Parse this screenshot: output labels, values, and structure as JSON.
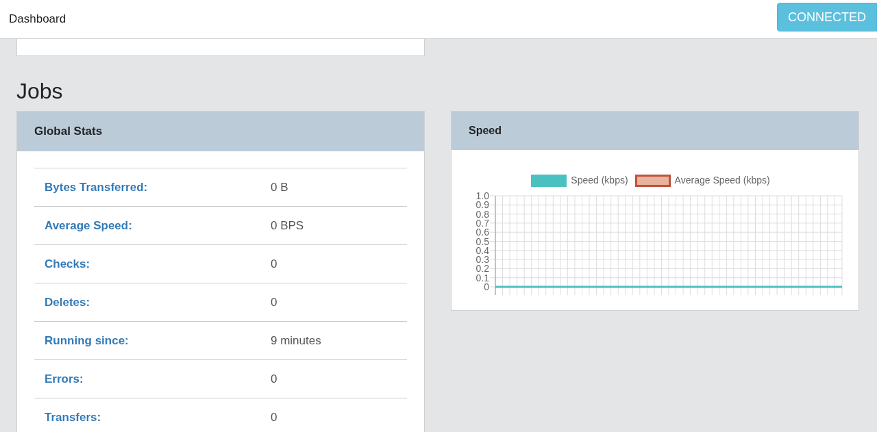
{
  "header": {
    "title": "Dashboard",
    "status_button": "CONNECTED"
  },
  "section_title": "Jobs",
  "global_stats": {
    "title": "Global Stats",
    "rows": [
      {
        "label": "Bytes Transferred:",
        "value": "0 B"
      },
      {
        "label": "Average Speed:",
        "value": "0 BPS"
      },
      {
        "label": "Checks:",
        "value": "0"
      },
      {
        "label": "Deletes:",
        "value": "0"
      },
      {
        "label": "Running since:",
        "value": "9 minutes"
      },
      {
        "label": "Errors:",
        "value": "0"
      },
      {
        "label": "Transfers:",
        "value": "0"
      }
    ]
  },
  "speed": {
    "title": "Speed",
    "chart_data": {
      "type": "line",
      "ylim": [
        0,
        1
      ],
      "yticks": [
        0,
        {
          "value": 0.1,
          "label": "0.1"
        },
        {
          "value": 0.2,
          "label": "0.2"
        },
        {
          "value": 0.3,
          "label": "0.3"
        },
        {
          "value": 0.4,
          "label": "0.4"
        },
        {
          "value": 0.5,
          "label": "0.5"
        },
        {
          "value": 0.6,
          "label": "0.6"
        },
        {
          "value": 0.7,
          "label": "0.7"
        },
        {
          "value": 0.8,
          "label": "0.8"
        },
        {
          "value": 0.9,
          "label": "0.9"
        },
        {
          "value": 1,
          "label": "1.0"
        }
      ],
      "series": [
        {
          "name": "Speed (kbps)",
          "color": "#4bc0c0",
          "values": [
            0,
            0,
            0,
            0,
            0,
            0,
            0,
            0,
            0,
            0,
            0,
            0,
            0,
            0,
            0,
            0,
            0,
            0,
            0,
            0,
            0,
            0,
            0,
            0,
            0,
            0,
            0,
            0,
            0,
            0,
            0,
            0,
            0,
            0,
            0,
            0,
            0,
            0,
            0,
            0,
            0,
            0,
            0,
            0,
            0,
            0,
            0,
            0,
            0
          ]
        },
        {
          "name": "Average Speed (kbps)",
          "color": "#c0503c",
          "values": [
            null,
            null,
            null,
            null,
            null,
            null,
            null,
            null,
            null,
            null,
            null,
            null,
            null,
            null,
            null,
            null,
            null,
            null,
            null,
            null,
            null,
            null,
            null,
            null,
            null,
            null,
            null,
            null,
            null,
            null,
            null,
            null,
            null,
            null,
            null,
            null,
            null,
            null,
            null,
            null,
            null,
            null,
            null,
            null,
            null,
            null,
            null,
            null,
            null
          ]
        }
      ],
      "grid": true
    }
  }
}
